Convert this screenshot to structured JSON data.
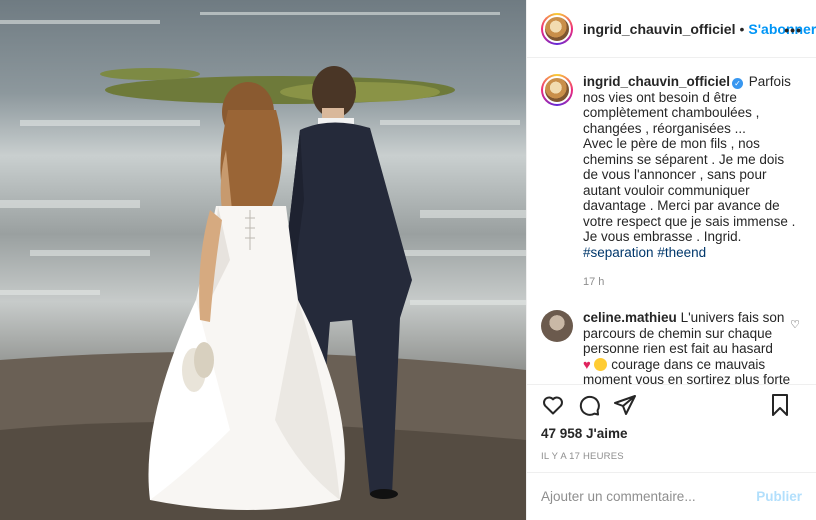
{
  "post": {
    "username": "ingrid_chauvin_officiel",
    "follow_label": "S'abonner",
    "more_label": "•••",
    "caption_text": "Parfois nos vies ont besoin d être complètement chamboulées , changées , réorganisées ...",
    "caption_text2": "Avec le père de mon fils , nos chemins se séparent . Je me dois de vous l'annoncer , sans pour autant vouloir communiquer davantage . Merci par avance de votre respect que je sais immense . Je vous embrasse . Ingrid.",
    "hashtags": [
      "#separation",
      "#theend"
    ],
    "time": "17 h",
    "likes": "47 958 J'aime",
    "ago": "IL Y A 17 HEURES",
    "comment_placeholder": "Ajouter un commentaire...",
    "post_label": "Publier"
  },
  "comment": {
    "username": "celine.mathieu",
    "text1": "L'univers fais son parcours de chemin sur chaque personne rien est fait au hasard",
    "text2": "courage dans ce mauvais moment vous en sortirez plus forte"
  },
  "icons": [
    "heart-icon",
    "comment-icon",
    "share-icon",
    "bookmark-icon",
    "verified-icon",
    "more-icon"
  ],
  "colors": {
    "link": "#0095f6",
    "hashtag": "#00376b",
    "muted": "#8e8e8e",
    "verified": "#3897f0"
  }
}
